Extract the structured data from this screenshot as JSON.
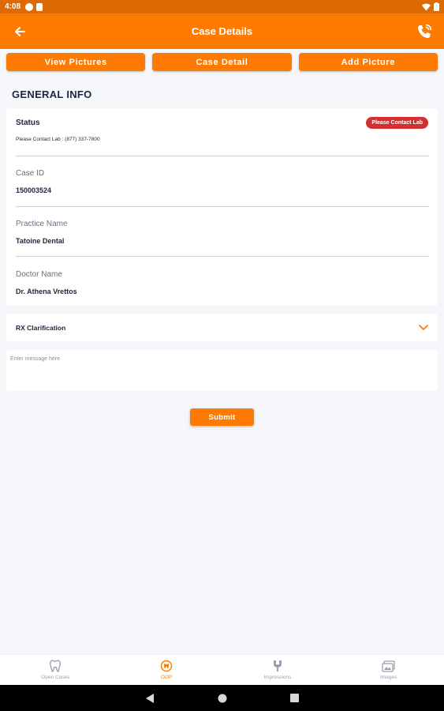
{
  "status_bar": {
    "time": "4:08"
  },
  "app_bar": {
    "title": "Case Details"
  },
  "top_buttons": [
    {
      "label": "View Pictures"
    },
    {
      "label": "Case Detail"
    },
    {
      "label": "Add Picture"
    }
  ],
  "section_title": "GENERAL INFO",
  "general_info": {
    "status_label": "Status",
    "status_badge": "Please Contact Lab",
    "status_note": "Please Contact Lab : (877) 337-7800",
    "case_id_label": "Case ID",
    "case_id_value": "150003524",
    "practice_label": "Practice Name",
    "practice_value": "Tatoine Dental",
    "doctor_label": "Doctor Name",
    "doctor_value": "Dr. Athena Vrettos"
  },
  "rx": {
    "label": "RX Clarification"
  },
  "message": {
    "placeholder": "Enter message here",
    "value": ""
  },
  "submit_label": "Submit",
  "bottom_nav": [
    {
      "label": "Open Cases",
      "icon": "tooth-icon",
      "active": false
    },
    {
      "label": "OOP",
      "icon": "oop-icon",
      "active": true
    },
    {
      "label": "Impressions",
      "icon": "impression-icon",
      "active": false
    },
    {
      "label": "Images",
      "icon": "images-icon",
      "active": false
    }
  ],
  "colors": {
    "primary": "#ff7a00",
    "status_bar": "#dd6a05",
    "badge": "#d32f2f",
    "text": "#1d2440"
  }
}
